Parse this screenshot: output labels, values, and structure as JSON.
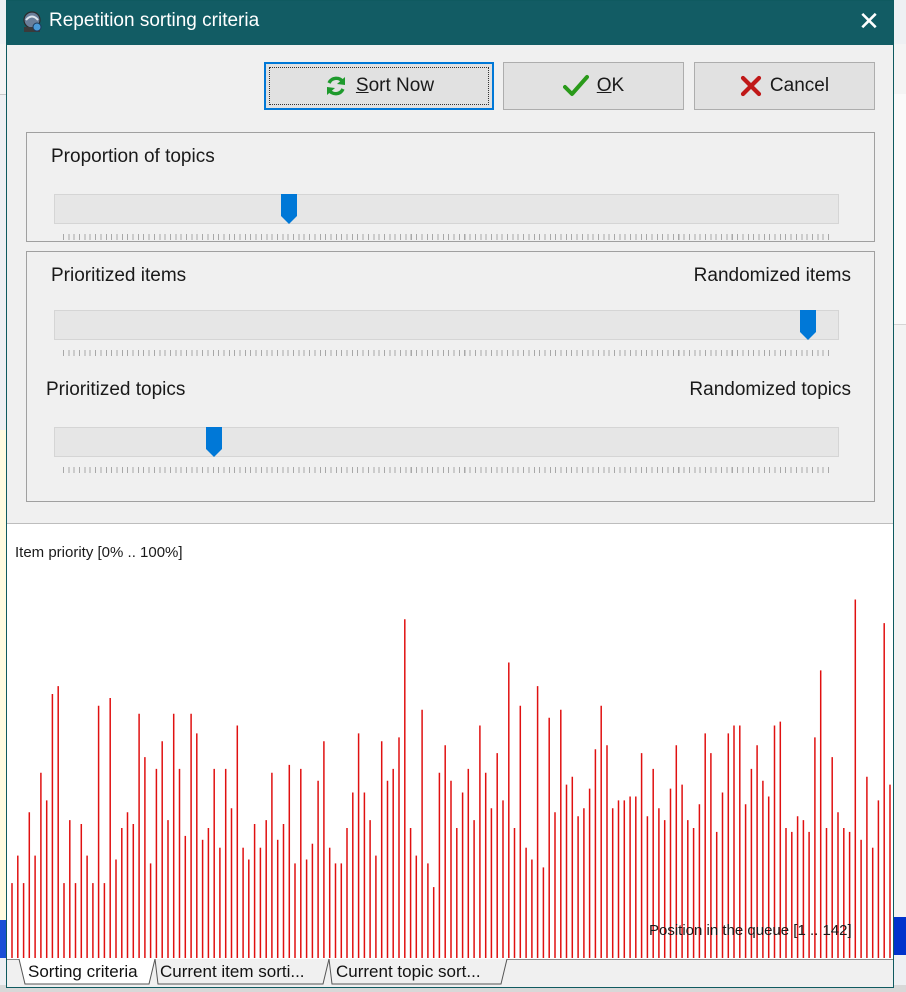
{
  "dialog": {
    "title": "Repetition sorting criteria",
    "close_glyph": "✕"
  },
  "buttons": {
    "sort_now": {
      "label_first": "S",
      "label_rest": "ort Now",
      "icon": "refresh-icon"
    },
    "ok": {
      "label_first": "O",
      "label_rest": "K",
      "icon": "checkmark-icon"
    },
    "cancel": {
      "label": "Cancel",
      "icon": "x-icon"
    }
  },
  "sliders": {
    "topics_proportion": {
      "label": "Proportion of topics",
      "value": 0.295
    },
    "items": {
      "left_label": "Prioritized items",
      "right_label": "Randomized items",
      "value": 0.97
    },
    "topics": {
      "left_label": "Prioritized topics",
      "right_label": "Randomized topics",
      "value": 0.198
    }
  },
  "chart_data": {
    "type": "bar",
    "ylabel": "Item priority [0% .. 100%]",
    "xlabel": "Position in the queue [1 .. 142]",
    "ylim": [
      0,
      100
    ],
    "xlim": [
      1,
      142
    ],
    "color": "#e01010",
    "values": [
      19,
      26,
      19,
      37,
      26,
      47,
      40,
      67,
      69,
      19,
      35,
      19,
      34,
      26,
      19,
      64,
      19,
      66,
      25,
      33,
      37,
      34,
      62,
      51,
      24,
      48,
      55,
      35,
      62,
      48,
      31,
      62,
      57,
      30,
      33,
      48,
      28,
      48,
      38,
      59,
      28,
      25,
      34,
      28,
      35,
      47,
      30,
      34,
      49,
      24,
      48,
      25,
      29,
      45,
      55,
      28,
      24,
      24,
      33,
      42,
      57,
      42,
      35,
      26,
      55,
      45,
      48,
      56,
      86,
      33,
      26,
      63,
      24,
      18,
      47,
      54,
      45,
      33,
      42,
      48,
      35,
      59,
      47,
      38,
      52,
      40,
      75,
      33,
      64,
      28,
      25,
      69,
      23,
      61,
      37,
      63,
      44,
      46,
      36,
      38,
      43,
      53,
      64,
      54,
      38,
      40,
      40,
      41,
      41,
      52,
      36,
      48,
      38,
      35,
      43,
      54,
      44,
      35,
      33,
      39,
      57,
      52,
      32,
      42,
      57,
      59,
      59,
      39,
      48,
      54,
      45,
      41,
      59,
      60,
      33,
      32,
      36,
      35,
      32,
      56,
      73,
      33,
      51,
      37,
      33,
      32,
      91,
      30,
      46,
      28,
      40,
      85,
      44
    ]
  },
  "tabs": [
    {
      "label": "Sorting criteria"
    },
    {
      "label": "Current item sorti..."
    },
    {
      "label": "Current topic sort..."
    }
  ],
  "colors": {
    "title_bar": "#125c64",
    "slider_thumb": "#0078d7",
    "bar": "#e01010"
  }
}
